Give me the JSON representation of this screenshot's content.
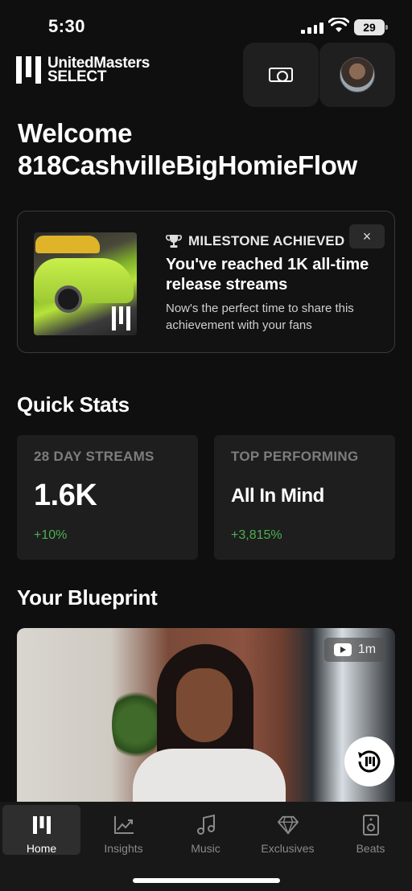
{
  "status_bar": {
    "time": "5:30",
    "battery": "29"
  },
  "header": {
    "logo_line1": "UnitedMasters",
    "logo_line2": "SELECT",
    "cash_icon": "cash-icon",
    "avatar_icon": "avatar"
  },
  "welcome": {
    "greeting": "Welcome",
    "username": "818CashvilleBigHomieFlow"
  },
  "milestone": {
    "badge": "MILESTONE ACHIEVED",
    "badge_icon": "trophy-icon",
    "close": "×",
    "title": "You've reached 1K all-time release streams",
    "text": "Now's the perfect time to share this achievement with your fans"
  },
  "quick_stats": {
    "title": "Quick Stats",
    "cards": [
      {
        "label": "28 DAY STREAMS",
        "value": "1.6K",
        "change": "+10%"
      },
      {
        "label": "TOP PERFORMING",
        "value": "All In Mind",
        "change": "+3,815%"
      }
    ]
  },
  "blueprint": {
    "title": "Your Blueprint",
    "duration": "1m"
  },
  "tabs": [
    {
      "label": "Home",
      "icon": "home-icon",
      "active": true
    },
    {
      "label": "Insights",
      "icon": "insights-icon",
      "active": false
    },
    {
      "label": "Music",
      "icon": "music-icon",
      "active": false
    },
    {
      "label": "Exclusives",
      "icon": "diamond-icon",
      "active": false
    },
    {
      "label": "Beats",
      "icon": "speaker-icon",
      "active": false
    }
  ],
  "colors": {
    "background": "#0f0f0f",
    "card": "#1e1e1e",
    "positive": "#4caf50",
    "muted": "#7d7d7d"
  }
}
